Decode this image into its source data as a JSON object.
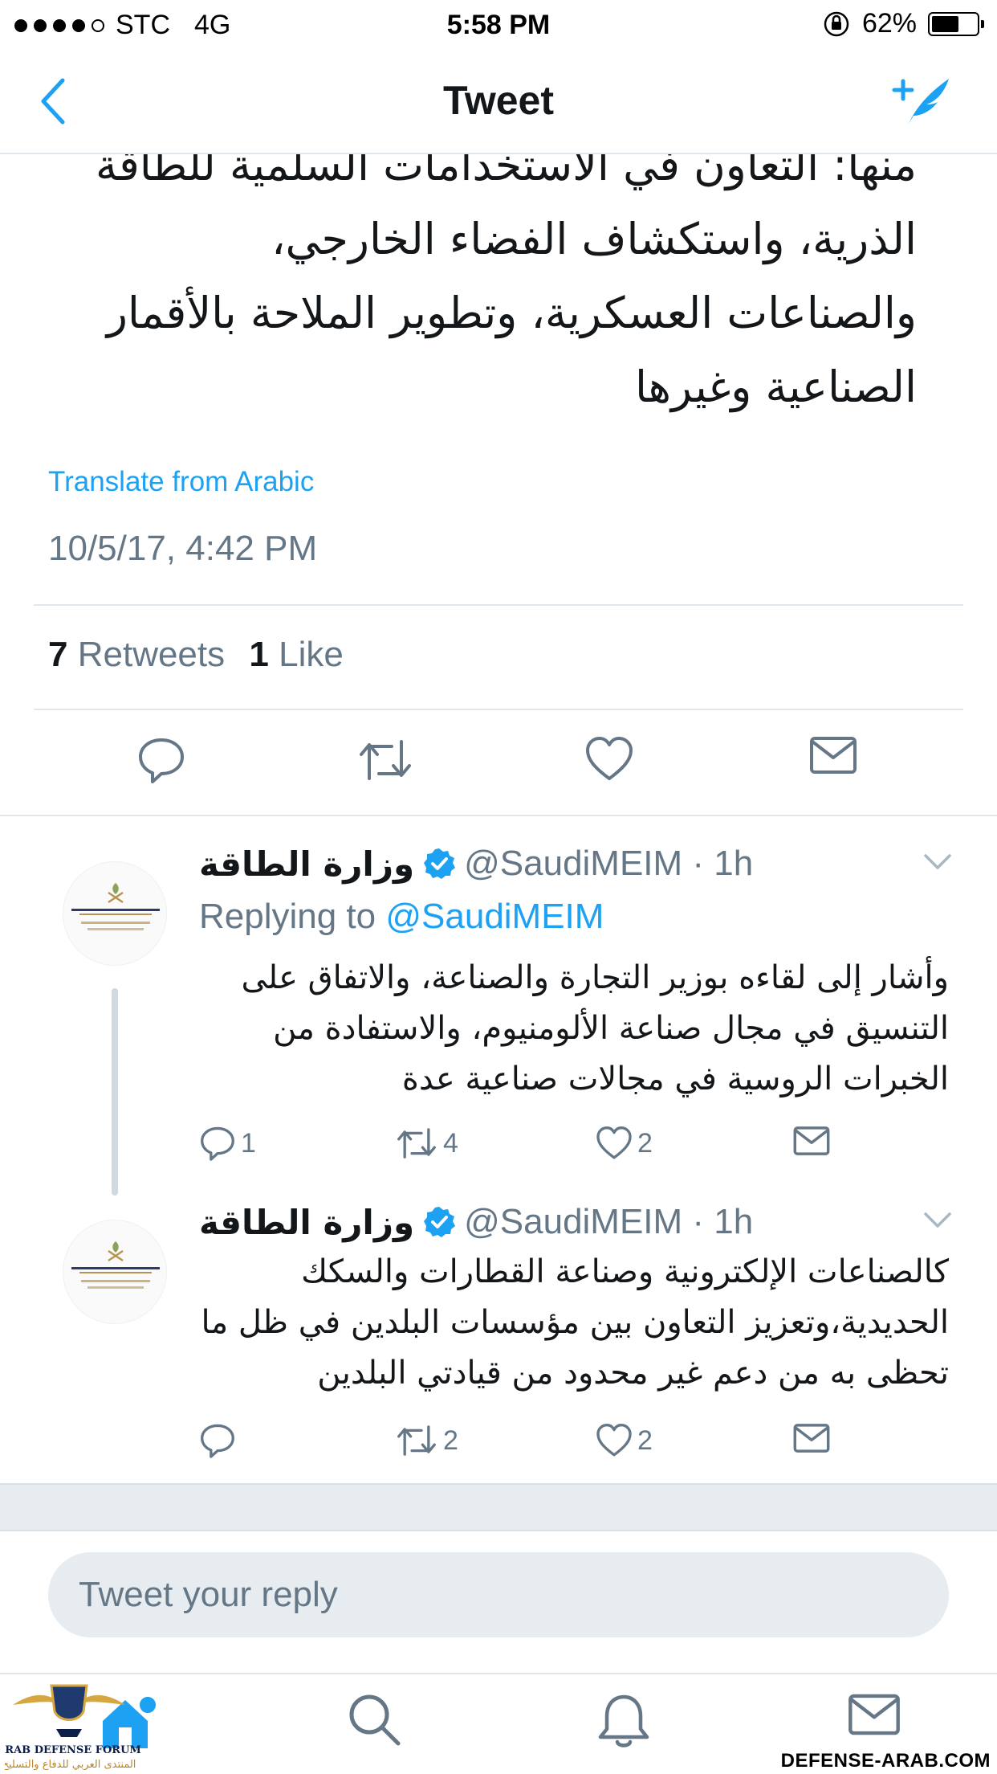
{
  "status_bar": {
    "carrier": "STC",
    "network": "4G",
    "time": "5:58 PM",
    "battery": "62%",
    "battery_level": 0.62
  },
  "nav": {
    "title": "Tweet",
    "back_icon": "chevron-left-icon",
    "compose_icon": "compose-tweet-icon"
  },
  "tweet": {
    "text_lines": [
      "منها: التعاون في الاستخدامات السلمية للطاقة",
      "الذرية، واستكشاف الفضاء الخارجي،",
      "والصناعات العسكرية، وتطوير الملاحة بالأقمار",
      "الصناعية وغيرها"
    ],
    "translate": "Translate from Arabic",
    "timestamp": "10/5/17, 4:42 PM",
    "retweets_count": "7",
    "retweets_label": "Retweets",
    "likes_count": "1",
    "likes_label": "Like"
  },
  "replies": [
    {
      "name": "وزارة الطاقة",
      "handle": "@SaudiMEIM · 1h",
      "replying_prefix": "Replying to ",
      "replying_handle": "@SaudiMEIM",
      "text_lines": [
        "وأشار إلى لقاءه بوزير التجارة والصناعة، والاتفاق على",
        "التنسيق في مجال صناعة الألومنيوم، والاستفادة من",
        "الخبرات الروسية في مجالات صناعية عدة"
      ],
      "reply_count": "1",
      "retweet_count": "4",
      "like_count": "2"
    },
    {
      "name": "وزارة الطاقة",
      "handle": "@SaudiMEIM · 1h",
      "text_lines": [
        "كالصناعات الإلكترونية وصناعة القطارات والسكك",
        "الحديدية،وتعزيز التعاون بين مؤسسات البلدين في ظل ما",
        "تحظى به من دعم غير محدود من قيادتي البلدين"
      ],
      "reply_count": "",
      "retweet_count": "2",
      "like_count": "2"
    }
  ],
  "reply_input": {
    "placeholder": "Tweet your reply"
  },
  "tabbar": {
    "items": [
      "home-icon",
      "search-icon",
      "notifications-icon",
      "messages-icon"
    ]
  },
  "watermark": {
    "logo_text": "ARAB DEFENSE FORUM",
    "logo_sub": "المنتدى العربي للدفاع والتسليح",
    "site": "DEFENSE-ARAB.COM"
  },
  "colors": {
    "accent": "#1da1f2",
    "text": "#14171a",
    "secondary": "#657786",
    "divider": "#e1e8ed",
    "verified": "#1da1f2"
  }
}
